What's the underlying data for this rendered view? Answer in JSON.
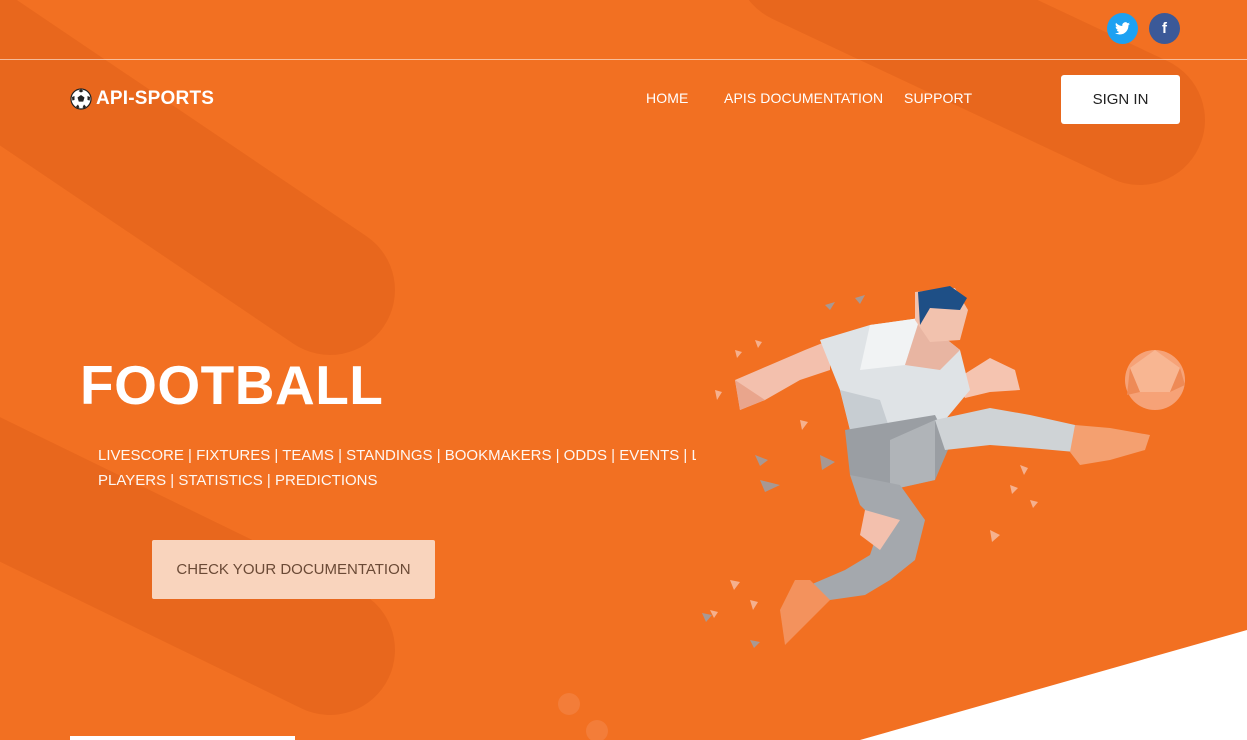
{
  "header": {
    "brand": "API-SPORTS",
    "social": [
      {
        "name": "twitter",
        "icon": "twitter-bird-icon",
        "color": "#1da1f2"
      },
      {
        "name": "facebook",
        "icon": "facebook-f-icon",
        "color": "#3b5998"
      }
    ],
    "nav": [
      {
        "label": "HOME"
      },
      {
        "label": "APIS DOCUMENTATION"
      },
      {
        "label": "SUPPORT"
      }
    ],
    "signin_label": "SIGN IN"
  },
  "hero": {
    "title": "FOOTBALL",
    "line1": "LIVESCORE | FIXTURES | TEAMS | STANDINGS | BOOKMAKERS | ODDS | EVENTS | LINE UP",
    "line2": "PLAYERS | STATISTICS | PREDICTIONS",
    "cta_label": "CHECK YOUR DOCUMENTATION"
  },
  "colors": {
    "background": "#f27022",
    "cta_background": "#f9d4bd",
    "signin_background": "#ffffff"
  }
}
